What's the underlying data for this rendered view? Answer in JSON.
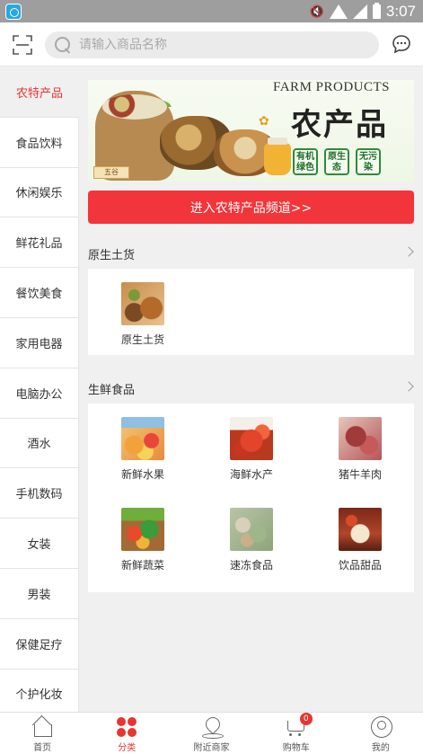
{
  "status_bar": {
    "time": "3:07"
  },
  "search": {
    "placeholder": "请输入商品名称"
  },
  "sidebar": {
    "items": [
      {
        "label": "农特产品",
        "active": true
      },
      {
        "label": "食品饮料"
      },
      {
        "label": "休闲娱乐"
      },
      {
        "label": "鲜花礼品"
      },
      {
        "label": "餐饮美食"
      },
      {
        "label": "家用电器"
      },
      {
        "label": "电脑办公"
      },
      {
        "label": "酒水"
      },
      {
        "label": "手机数码"
      },
      {
        "label": "女装"
      },
      {
        "label": "男装"
      },
      {
        "label": "保健足疗"
      },
      {
        "label": "个护化妆"
      }
    ]
  },
  "banner": {
    "title_en": "FARM PRODUCTS",
    "title_cn": "农产品",
    "badges": [
      "有机绿色",
      "原生态",
      "无污染"
    ],
    "sack_tag": "五谷"
  },
  "enter_button": {
    "label": "进入农特产品频道>>"
  },
  "sections": [
    {
      "title": "原生土货",
      "items": [
        {
          "label": "原生土货",
          "image": "native-goods"
        }
      ]
    },
    {
      "title": "生鲜食品",
      "items": [
        {
          "label": "新鲜水果",
          "image": "fresh-fruit"
        },
        {
          "label": "海鲜水产",
          "image": "seafood"
        },
        {
          "label": "猪牛羊肉",
          "image": "meat"
        },
        {
          "label": "新鲜蔬菜",
          "image": "vegetables"
        },
        {
          "label": "速冻食品",
          "image": "frozen-food"
        },
        {
          "label": "饮品甜品",
          "image": "drinks-desserts"
        }
      ]
    }
  ],
  "bottom_nav": {
    "items": [
      {
        "label": "首页",
        "icon": "home-icon"
      },
      {
        "label": "分类",
        "icon": "category-icon",
        "active": true
      },
      {
        "label": "附近商家",
        "icon": "location-icon"
      },
      {
        "label": "购物车",
        "icon": "cart-icon",
        "badge": "0"
      },
      {
        "label": "我的",
        "icon": "profile-icon"
      }
    ]
  },
  "colors": {
    "accent": "#e8352f",
    "button": "#f2353a",
    "background": "#f0f0f0"
  }
}
